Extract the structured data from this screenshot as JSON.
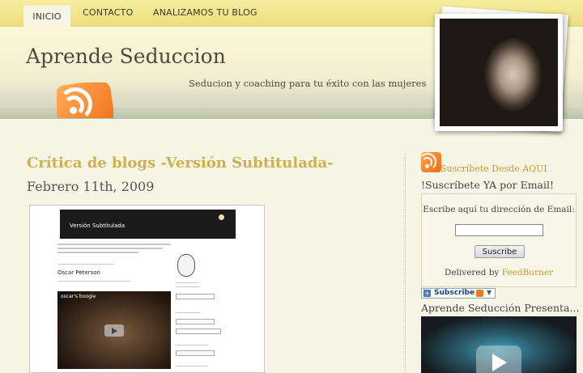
{
  "nav": {
    "items": [
      "INICIO",
      "CONTACTO",
      "ANALIZAMOS TU BLOG"
    ]
  },
  "header": {
    "title": "Aprende Seduccion",
    "tagline": "Seducion y coaching para tu éxito con las mujeres"
  },
  "post": {
    "title": "Crítica de blogs -Versión Subtitulada-",
    "date": "Febrero 11th, 2009",
    "screenshot": {
      "banner_text": "Versión Subtitulada",
      "name": "Oscar Peterson",
      "video_title": "oscar's boogie"
    }
  },
  "sidebar": {
    "subscribe_link": "Suscríbete Desde AQUI",
    "email_heading": "!Suscríbete YA por Email!",
    "form_label": "Escribe aquí tu dirección de Email:",
    "email_value": "",
    "submit_label": "Suscribe",
    "delivered_prefix": "Delivered by",
    "delivered_link": "FeedBurner",
    "badge_label": "Subscribe",
    "presenta_heading": "Aprende Seducción Presenta..."
  },
  "colors": {
    "accent": "#d0b04e",
    "link": "#c49a30",
    "nav_bg": "#f0e28a",
    "rss_orange": "#f06a10"
  },
  "icons": [
    "rss-feed-icon",
    "rss-small-icon",
    "play-icon"
  ]
}
